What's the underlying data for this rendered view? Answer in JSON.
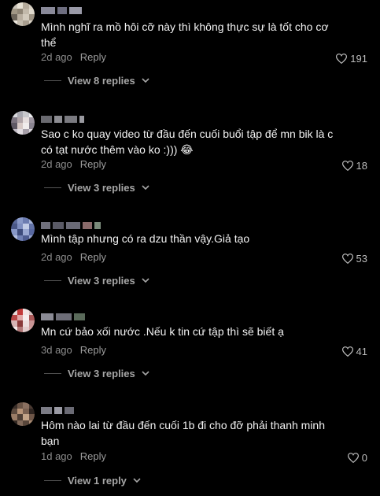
{
  "comments": [
    {
      "username": "",
      "text": "Mình nghĩ ra mồ hôi cỡ này thì không thực sự là tốt cho cơ thể",
      "time": "2d ago",
      "reply_label": "Reply",
      "likes": "191",
      "view_replies": "View 8 replies"
    },
    {
      "username": "",
      "text": "Sao c ko quay video từ đầu đến cuối buổi tập để mn bik là c có tạt nước thêm vào ko :))) 😂",
      "time": "2d ago",
      "reply_label": "Reply",
      "likes": "18",
      "view_replies": "View 3 replies"
    },
    {
      "username": "",
      "text": "Mình tập nhưng có ra dzu thần vậy.Giả tạo",
      "time": "2d ago",
      "reply_label": "Reply",
      "likes": "53",
      "view_replies": "View 3 replies"
    },
    {
      "username": "",
      "text": "Mn cứ bảo xối nước .Nếu k tin cứ tập thì sẽ biết ạ",
      "time": "3d ago",
      "reply_label": "Reply",
      "likes": "41",
      "view_replies": "View 3 replies"
    },
    {
      "username": "",
      "text": "Hôm nào lai từ đầu đến cuối 1b đi cho đỡ phải thanh minh bạn",
      "time": "1d ago",
      "reply_label": "Reply",
      "likes": "0",
      "view_replies": "View 1 reply"
    }
  ]
}
